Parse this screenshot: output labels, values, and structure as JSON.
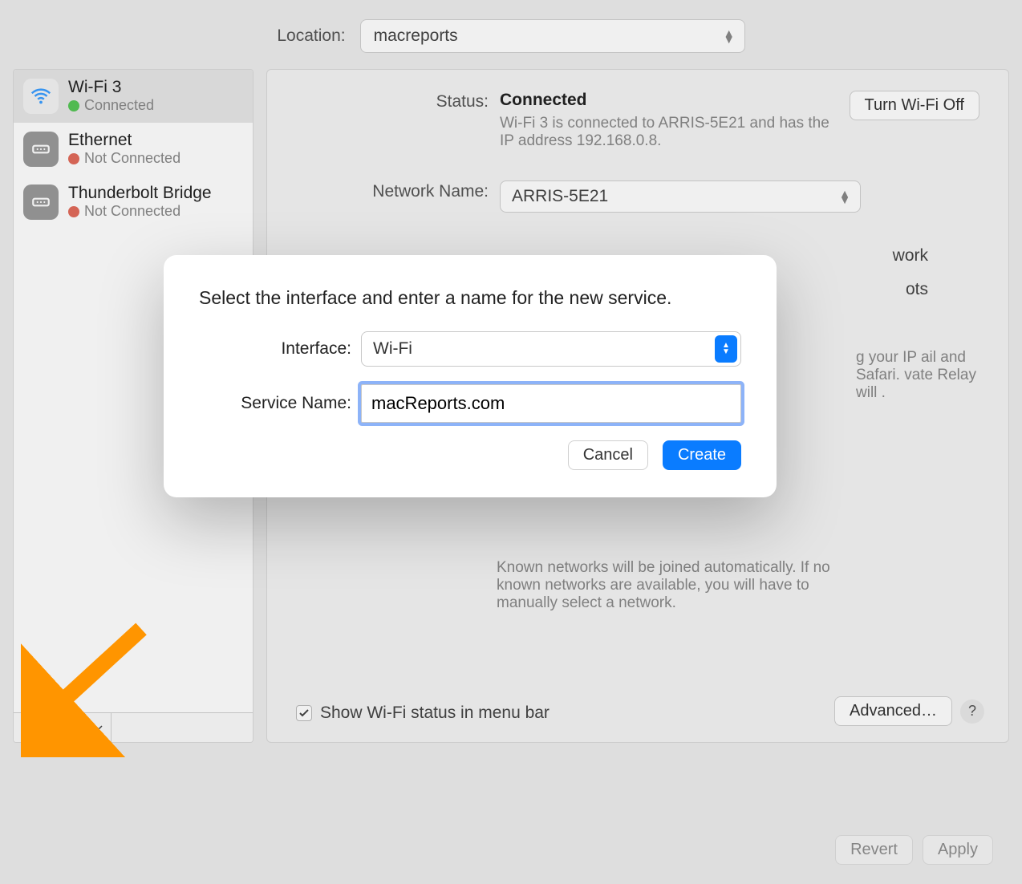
{
  "location": {
    "label": "Location:",
    "value": "macreports"
  },
  "sidebar": {
    "items": [
      {
        "name": "Wi-Fi 3",
        "status": "Connected",
        "dot": "green",
        "icon": "wifi"
      },
      {
        "name": "Ethernet",
        "status": "Not Connected",
        "dot": "red",
        "icon": "eth"
      },
      {
        "name": "Thunderbolt Bridge",
        "status": "Not Connected",
        "dot": "red",
        "icon": "eth"
      }
    ]
  },
  "detail": {
    "status_label": "Status:",
    "status_value": "Connected",
    "status_desc": "Wi-Fi 3 is connected to ARRIS-5E21 and has the IP address 192.168.0.8.",
    "turn_off": "Turn Wi-Fi Off",
    "network_label": "Network Name:",
    "network_value": "ARRIS-5E21",
    "partial_work": "work",
    "partial_ots": "ots",
    "relay_text": "g your IP ail and Safari. vate Relay will .",
    "known_text": "Known networks will be joined automatically. If no known networks are available, you will have to manually select a network.",
    "show_menu": "Show Wi-Fi status in menu bar",
    "advanced": "Advanced…"
  },
  "footer": {
    "revert": "Revert",
    "apply": "Apply"
  },
  "modal": {
    "prompt": "Select the interface and enter a name for the new service.",
    "interface_label": "Interface:",
    "interface_value": "Wi-Fi",
    "service_label": "Service Name:",
    "service_value": "macReports.com",
    "cancel": "Cancel",
    "create": "Create"
  }
}
